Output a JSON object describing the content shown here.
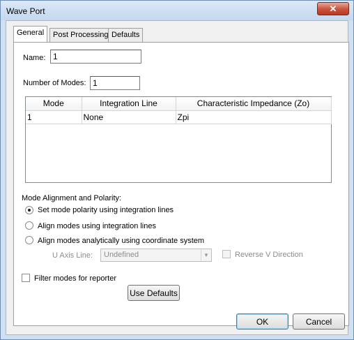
{
  "window": {
    "title": "Wave Port",
    "close_glyph": "✕"
  },
  "tabs": [
    {
      "label": "General"
    },
    {
      "label": "Post Processing"
    },
    {
      "label": "Defaults"
    }
  ],
  "general": {
    "name_label": "Name:",
    "name_value": "1",
    "modes_label": "Number of Modes:",
    "modes_value": "1",
    "table": {
      "headers": [
        "Mode",
        "Integration Line",
        "Characteristic Impedance (Zo)"
      ],
      "rows": [
        [
          "1",
          "None",
          "Zpi"
        ]
      ]
    },
    "alignment_label": "Mode Alignment and Polarity:",
    "radio_options": [
      {
        "label": "Set mode polarity using integration lines",
        "selected": true
      },
      {
        "label": "Align modes using integration lines",
        "selected": false
      },
      {
        "label": "Align modes analytically using coordinate system",
        "selected": false
      }
    ],
    "u_axis_label": "U Axis Line:",
    "u_axis_value": "Undefined",
    "reverse_v_label": "Reverse V Direction",
    "filter_label": "Filter modes for reporter",
    "use_defaults_label": "Use Defaults"
  },
  "footer": {
    "ok_label": "OK",
    "cancel_label": "Cancel"
  }
}
